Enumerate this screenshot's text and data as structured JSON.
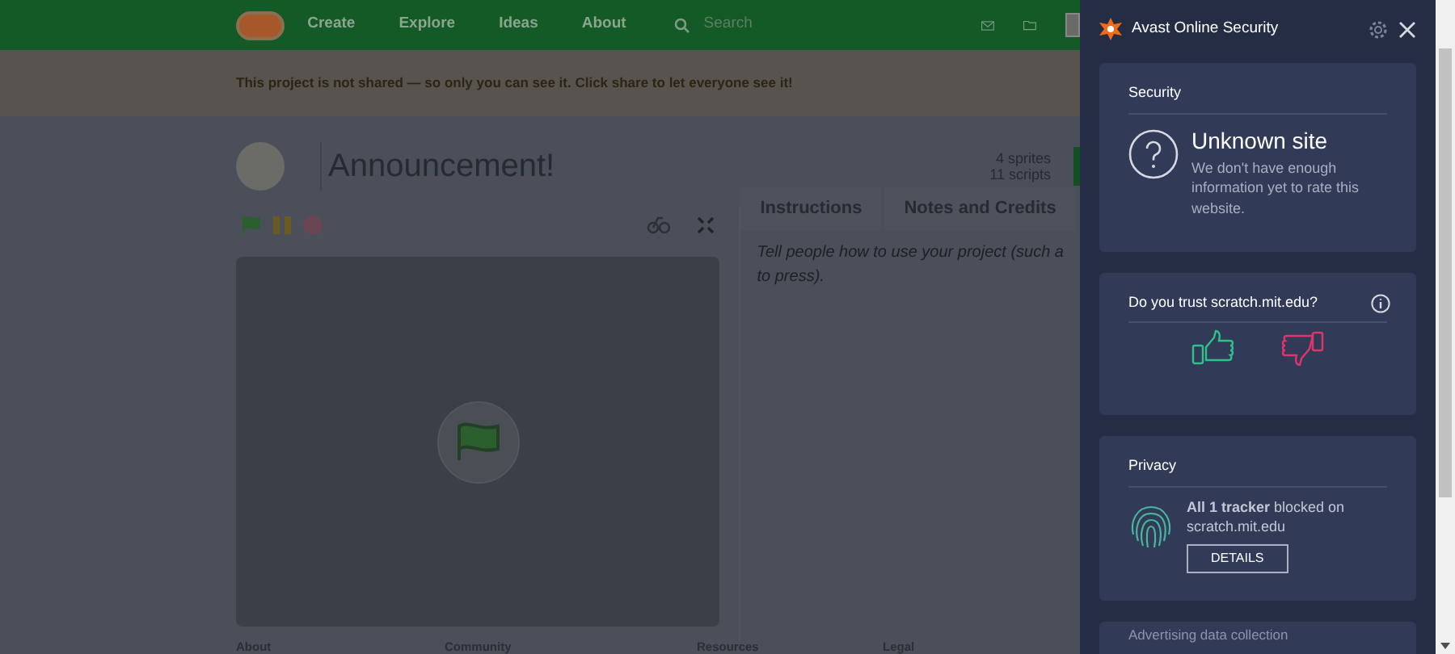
{
  "navbar": {
    "items": [
      "Create",
      "Explore",
      "Ideas",
      "About"
    ],
    "search": {
      "placeholder": "Search"
    }
  },
  "banner": "This project is not shared — so only you can see it. Click share to let everyone see it!",
  "project": {
    "title": "Announcement!",
    "stats": [
      "4 sprites",
      "11 scripts"
    ]
  },
  "tabs": [
    "Instructions",
    "Notes and Credits"
  ],
  "instructions_lines": [
    "Tell people how to use your project (such a",
    "to press)."
  ],
  "footer": [
    "About",
    "Community",
    "Resources",
    "Legal"
  ],
  "panel": {
    "title": "Avast Online Security",
    "security": {
      "heading": "Security",
      "status": "Unknown site",
      "description": "We don't have enough information yet to rate this website."
    },
    "trust": {
      "question": "Do you trust scratch.mit.edu?"
    },
    "privacy": {
      "heading": "Privacy",
      "text": "**All 1 tracker** blocked on scratch.mit.edu",
      "button": "DETAILS"
    },
    "next_card": {
      "heading": "Advertising data collection"
    }
  }
}
